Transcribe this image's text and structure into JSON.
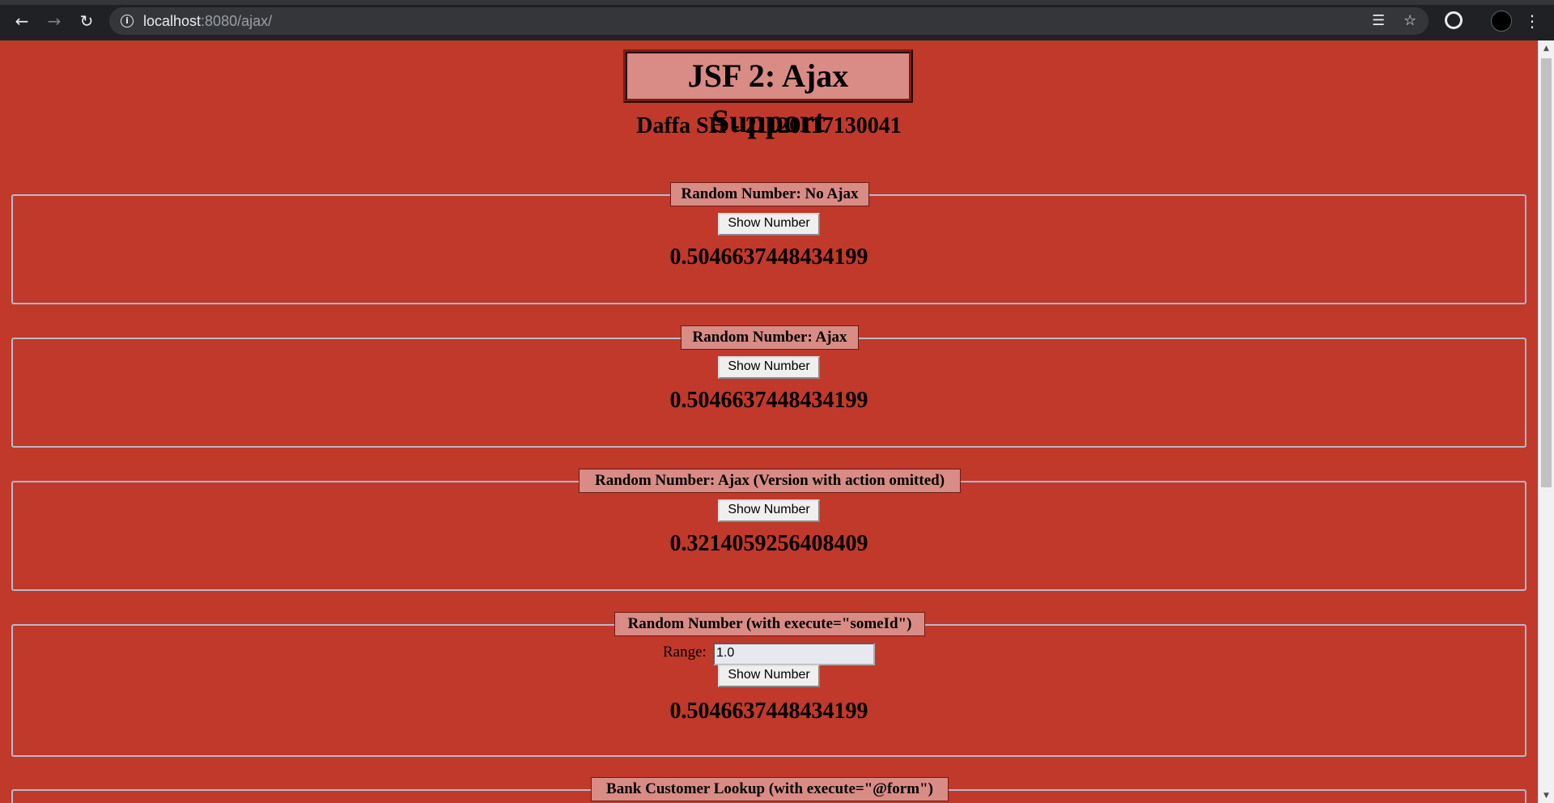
{
  "browser": {
    "url_host": "localhost",
    "url_path": ":8080/ajax/"
  },
  "page": {
    "title": "JSF 2: Ajax Support",
    "subtitle": "Daffa SH - 21120117130041"
  },
  "sections": [
    {
      "legend": "Random Number: No Ajax",
      "button_label": "Show Number",
      "number": "0.5046637448434199"
    },
    {
      "legend": "Random Number: Ajax",
      "button_label": "Show Number",
      "number": "0.5046637448434199"
    },
    {
      "legend": "Random Number: Ajax (Version with action omitted)",
      "button_label": "Show Number",
      "number": "0.3214059256408409"
    },
    {
      "legend": "Random Number (with execute=\"someId\")",
      "range_label": "Range:",
      "range_value": "1.0",
      "button_label": "Show Number",
      "number": "0.5046637448434199"
    },
    {
      "legend": "Bank Customer Lookup (with execute=\"@form\")"
    }
  ]
}
